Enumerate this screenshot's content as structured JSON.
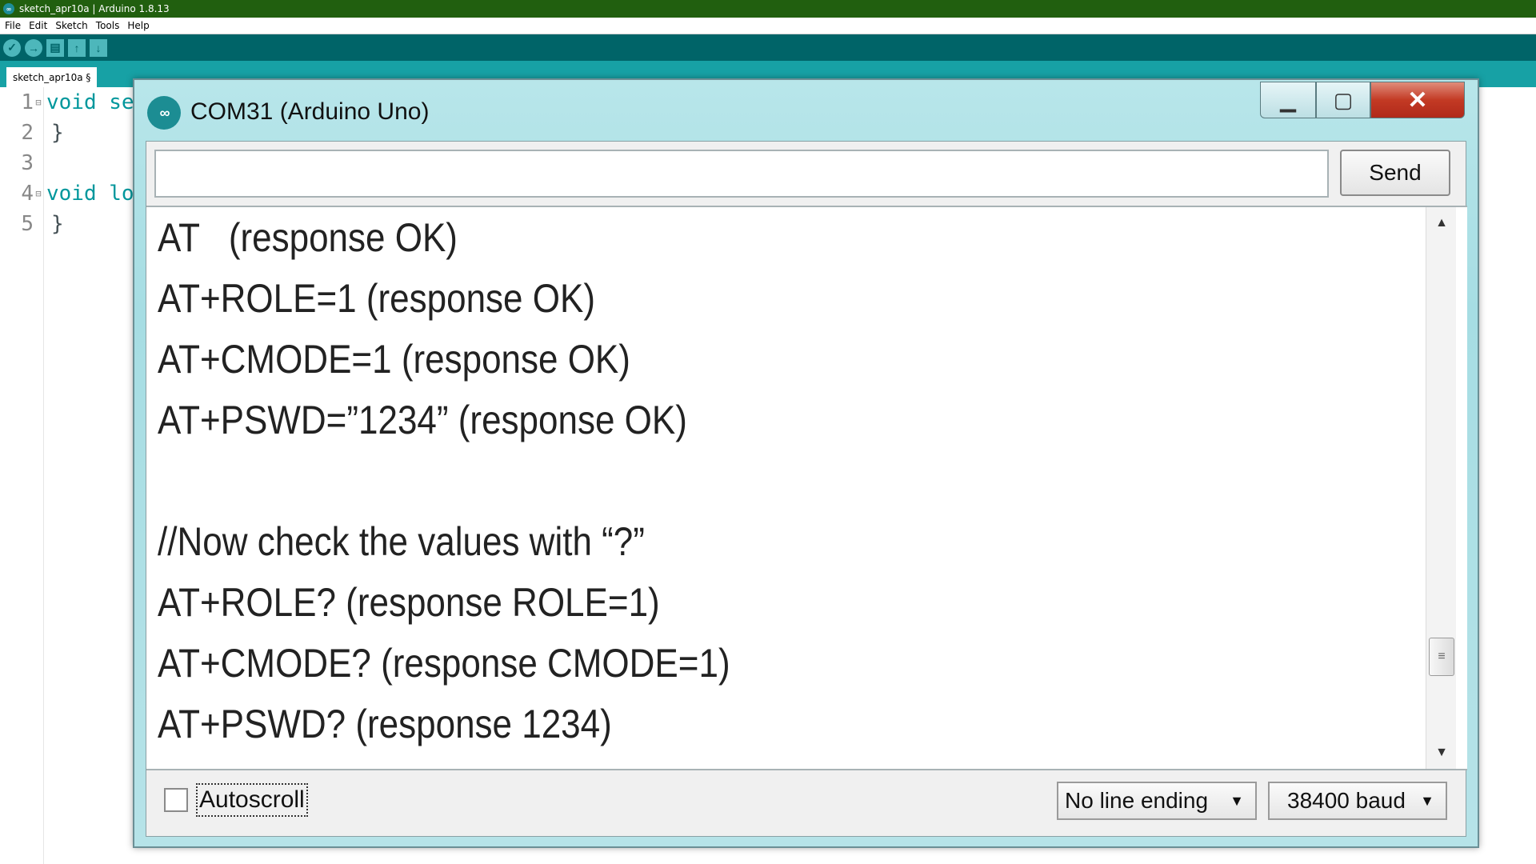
{
  "ide": {
    "window_title": "sketch_apr10a | Arduino 1.8.13",
    "menu": [
      "File",
      "Edit",
      "Sketch",
      "Tools",
      "Help"
    ],
    "tab_label": "sketch_apr10a §",
    "code_lines": [
      {
        "num": "1",
        "text": "void se"
      },
      {
        "num": "2",
        "text": "}"
      },
      {
        "num": "3",
        "text": ""
      },
      {
        "num": "4",
        "text": "void lo"
      },
      {
        "num": "5",
        "text": "}"
      }
    ]
  },
  "serial_monitor": {
    "title": "COM31 (Arduino Uno)",
    "input_value": "",
    "send_label": "Send",
    "output_lines": [
      "AT   (response OK)",
      "AT+ROLE=1 (response OK)",
      "AT+CMODE=1 (response OK)",
      "AT+PSWD=”1234” (response OK)",
      "",
      "//Now check the values with “?”",
      "AT+ROLE? (response ROLE=1)",
      "AT+CMODE? (response CMODE=1)",
      "AT+PSWD? (response 1234)"
    ],
    "autoscroll_label": "Autoscroll",
    "autoscroll_checked": false,
    "line_ending": "No line ending",
    "baud": "38400 baud"
  }
}
